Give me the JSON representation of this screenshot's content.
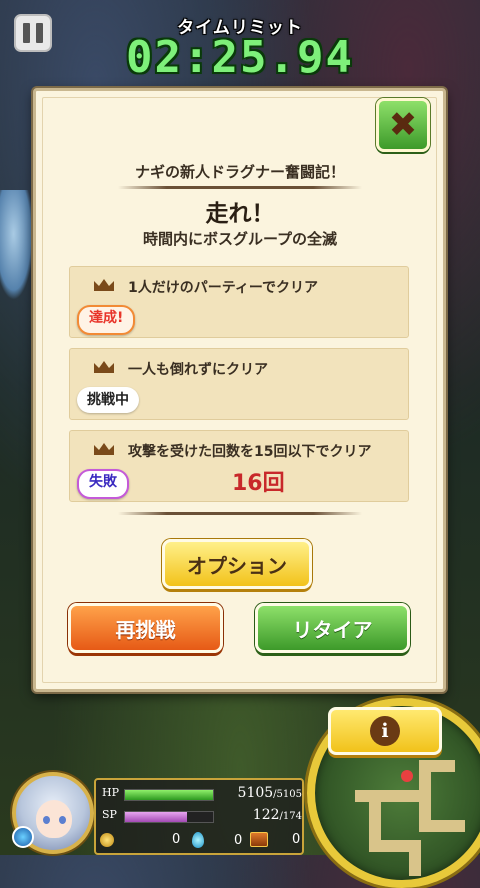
{
  "timer": {
    "label": "タイムリミット",
    "value": "02:25.94"
  },
  "dialog": {
    "subtitle": "ナギの新人ドラグナー奮闘記！",
    "quest_title": "走れ！",
    "quest_goal": "時間内にボスグループの全滅",
    "missions": [
      {
        "text": "1人だけのパーティーでクリア",
        "status": "達成!"
      },
      {
        "text": "一人も倒れずにクリア",
        "status": "挑戦中"
      },
      {
        "text": "攻撃を受けた回数を15回以下でクリア",
        "status": "失敗",
        "count": "16回"
      }
    ],
    "buttons": {
      "option": "オプション",
      "retry": "再挑戦",
      "retire": "リタイア"
    }
  },
  "hud": {
    "hp_label": "HP",
    "hp_current": "5105",
    "hp_max": "/5105",
    "hp_ratio": 1.0,
    "sp_label": "SP",
    "sp_current": "122",
    "sp_max": "/174",
    "sp_ratio": 0.7,
    "coins": "0",
    "drops": "0",
    "chests": "0"
  },
  "icons": {
    "close": "close-icon",
    "pause": "pause-icon",
    "crown": "crown-icon",
    "info": "info-icon",
    "coin": "coin-icon",
    "drop": "drop-icon",
    "chest": "chest-icon"
  },
  "colors": {
    "timer": "#7ef07a",
    "fail_count": "#c8282a",
    "success": "#e8342a",
    "fail": "#3a2ac0"
  }
}
